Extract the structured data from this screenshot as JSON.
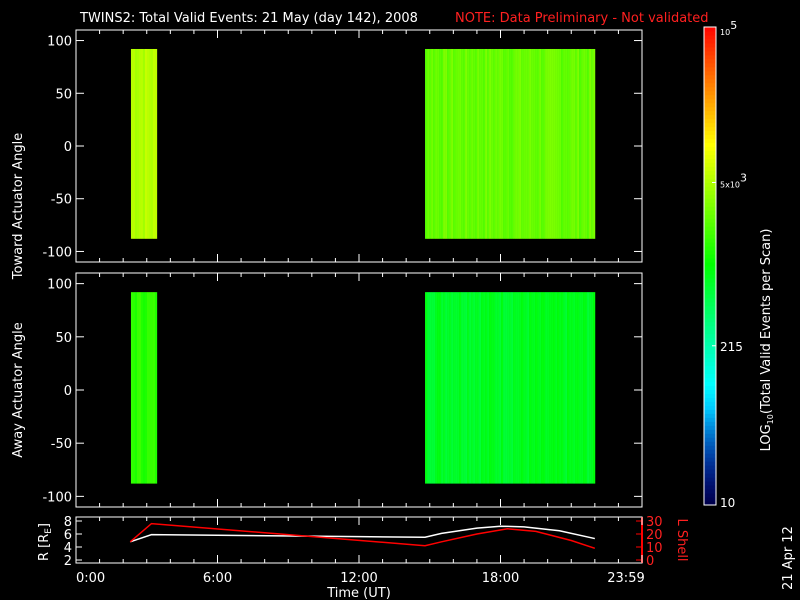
{
  "title": {
    "main": "TWINS2: Total Valid Events: 21 May (day 142), 2008",
    "note": "NOTE: Data Preliminary - Not validated"
  },
  "stamp": "21 Apr 12",
  "colors": {
    "note": "#ff2020",
    "r_line": "#ffffff",
    "lshell_line": "#ff0000"
  },
  "chart_data": [
    {
      "type": "heatmap",
      "name": "toward",
      "ylabel": "Toward Actuator Angle",
      "ylim": [
        -110,
        110
      ],
      "yticks": [
        100,
        50,
        0,
        -50,
        -100
      ],
      "angle_range": [
        -88,
        92
      ],
      "blocks": [
        {
          "start_hr": 2.33,
          "end_hr": 3.4,
          "typical_events": 5200
        },
        {
          "start_hr": 14.8,
          "end_hr": 22.0,
          "typical_events": 2600
        }
      ]
    },
    {
      "type": "heatmap",
      "name": "away",
      "ylabel": "Away Actuator Angle",
      "ylim": [
        -110,
        110
      ],
      "yticks": [
        100,
        50,
        0,
        -50,
        -100
      ],
      "angle_range": [
        -88,
        92
      ],
      "blocks": [
        {
          "start_hr": 2.33,
          "end_hr": 3.4,
          "typical_events": 1500
        },
        {
          "start_hr": 14.8,
          "end_hr": 22.0,
          "typical_events": 750
        }
      ]
    },
    {
      "type": "line",
      "name": "orbit",
      "xlabel": "Time (UT)",
      "xticks": [
        "0:00",
        "6:00",
        "12:00",
        "18:00",
        "23:59"
      ],
      "xlim": [
        0,
        24
      ],
      "ylabel_left": "R [R_E]",
      "ylabel_left_main": "R [R",
      "ylabel_left_sub": "E",
      "ylabel_left_end": "]",
      "ylim_left": [
        2,
        8
      ],
      "yticks_left": [
        "8",
        "6",
        "4",
        "2"
      ],
      "ylabel_right": "L Shell",
      "ylim_right": [
        0,
        30
      ],
      "yticks_right": [
        "30",
        "20",
        "10",
        "0"
      ],
      "series": [
        {
          "name": "R",
          "axis": "left",
          "x": [
            2.3,
            3.2,
            6.0,
            12.0,
            14.8,
            15.5,
            17.0,
            18.0,
            19.0,
            20.5,
            22.0
          ],
          "y": [
            4.8,
            5.9,
            5.8,
            5.6,
            5.5,
            6.1,
            6.9,
            7.2,
            7.1,
            6.5,
            5.3
          ]
        },
        {
          "name": "L Shell",
          "axis": "right",
          "x": [
            2.3,
            3.2,
            14.8,
            15.5,
            17.0,
            18.3,
            19.5,
            21.0,
            22.0
          ],
          "y": [
            14,
            28,
            11,
            14,
            20,
            24,
            22,
            15,
            9
          ]
        }
      ]
    },
    {
      "type": "colorbar",
      "title": "LOG10(Total Valid Events per Scan)",
      "title_main": "LOG",
      "title_sub": "10",
      "title_end": "(Total Valid Events per Scan)",
      "scale": "log",
      "range": [
        10,
        100000
      ],
      "ticks": [
        {
          "value": 10,
          "label": "10"
        },
        {
          "value": 215,
          "label": "215"
        },
        {
          "value": 5000,
          "label": "5x10",
          "sup": "3"
        },
        {
          "value": 100000,
          "label": "10",
          "sup": "5"
        }
      ]
    }
  ]
}
